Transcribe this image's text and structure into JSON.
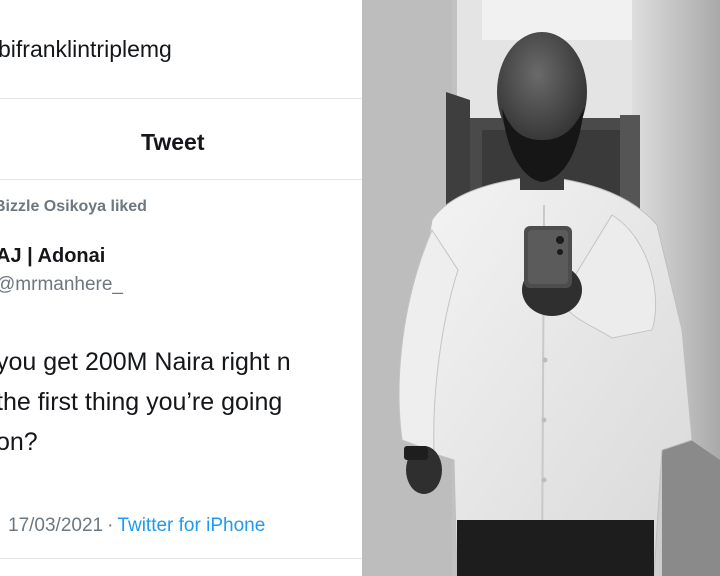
{
  "tweet": {
    "profile_handle": "bifranklintriplemg",
    "header_title": "Tweet",
    "liked_by": "Bizzle Osikoya liked",
    "author_name": "AJ | Adonai",
    "author_handle": "@mrmanhere_",
    "text_lines": [
      "you get 200M Naira right n",
      "the first thing you’re going",
      "on?"
    ],
    "date": "17/03/2021",
    "separator": "·",
    "source": "Twitter for iPhone",
    "colors": {
      "text": "#141619",
      "muted": "#6d7780",
      "link": "#1d9bf0",
      "divider": "#e3e6e8"
    }
  },
  "photo": {
    "subject": "man-mirror-selfie",
    "style": "grayscale"
  }
}
